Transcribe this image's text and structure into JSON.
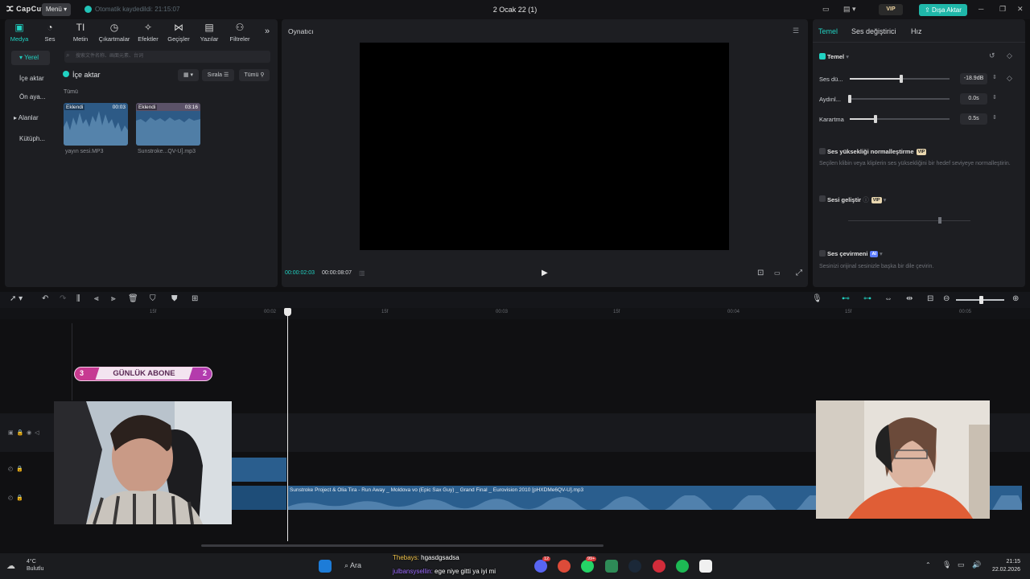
{
  "titlebar": {
    "logo": "CapCut",
    "menu": "Menü",
    "autosave": "Otomatik kaydedildi: 21:15:07",
    "title": "2 Ocak 22 (1)",
    "vip": "VIP",
    "export": "Dışa Aktar"
  },
  "media": {
    "tabs": [
      "Medya",
      "Ses",
      "Metin",
      "Çıkartmalar",
      "Efektler",
      "Geçişler",
      "Yazılar",
      "Filtreler"
    ],
    "sidebar": [
      "Yerel",
      "İçe aktar",
      "Ön aya...",
      "Alanlar",
      "Kütüph..."
    ],
    "search_placeholder": "搜索文件名称、画面元素、台词",
    "import_label": "İçe aktar",
    "sort_label": "Sırala",
    "filter_label": "Tümü",
    "section_label": "Tümü",
    "clips": [
      {
        "tag": "Eklendi",
        "duration": "00:03",
        "name": "yayın sesi.MP3"
      },
      {
        "tag": "Eklendi",
        "duration": "03:16",
        "name": "Sunstroke...QV-U].mp3"
      }
    ]
  },
  "player": {
    "title": "Oynatıcı",
    "current_time": "00:00:02:03",
    "total_time": "00:00:08:07"
  },
  "inspector": {
    "tabs": [
      "Temel",
      "Ses değiştirici",
      "Hız"
    ],
    "section": "Temel",
    "volume_label": "Ses dü...",
    "volume_value": "-18.9dB",
    "volume_level": 0.52,
    "fadein_label": "Aydınl...",
    "fadein_value": "0.0s",
    "fadein_level": 0.0,
    "fadeout_label": "Karartma",
    "fadeout_value": "0.5s",
    "fadeout_level": 0.26,
    "normalize_title": "Ses yüksekliği normalleştirme",
    "normalize_desc": "Seçilen klibin veya kliplerin ses yüksekliğini bir hedef seviyeye normalleştirin.",
    "enhance_title": "Sesi geliştir",
    "translate_title": "Ses çevirmeni",
    "translate_desc": "Sesinizi orijinal sesinizle başka bir dile çevirin.",
    "badge_vip": "VIP",
    "badge_ai": "AI"
  },
  "timeline": {
    "ruler": [
      "15f",
      "00:02",
      "15f",
      "00:03",
      "15f",
      "00:04",
      "15f",
      "00:05"
    ],
    "sticker": {
      "left": "3",
      "text": "GÜNLÜK ABONE",
      "right": "2"
    },
    "audio_clip_name": "Sunstroke Project & Olia Tira - Run Away _ Moldova vo (Epic Sax Guy) _ Grand Final _ Eurovision 2010 [pHXDMe6QV-U].mp3"
  },
  "taskbar": {
    "weather_temp": "4°C",
    "weather_desc": "Bulutlu",
    "search": "Ara",
    "chat": [
      {
        "user": "Thebays:",
        "text": "hgasdgsadsa"
      },
      {
        "user": "julbansysellin:",
        "text": "ege niye gitti ya iyi mi"
      }
    ],
    "time": "21:15",
    "date": "22.02.2026",
    "badge_discord": "12",
    "badge_whatsapp": "99+"
  },
  "colors": {
    "accent": "#21d2c2",
    "audio_clip": "#2a5e8e",
    "sticker": "#c93a8e"
  }
}
